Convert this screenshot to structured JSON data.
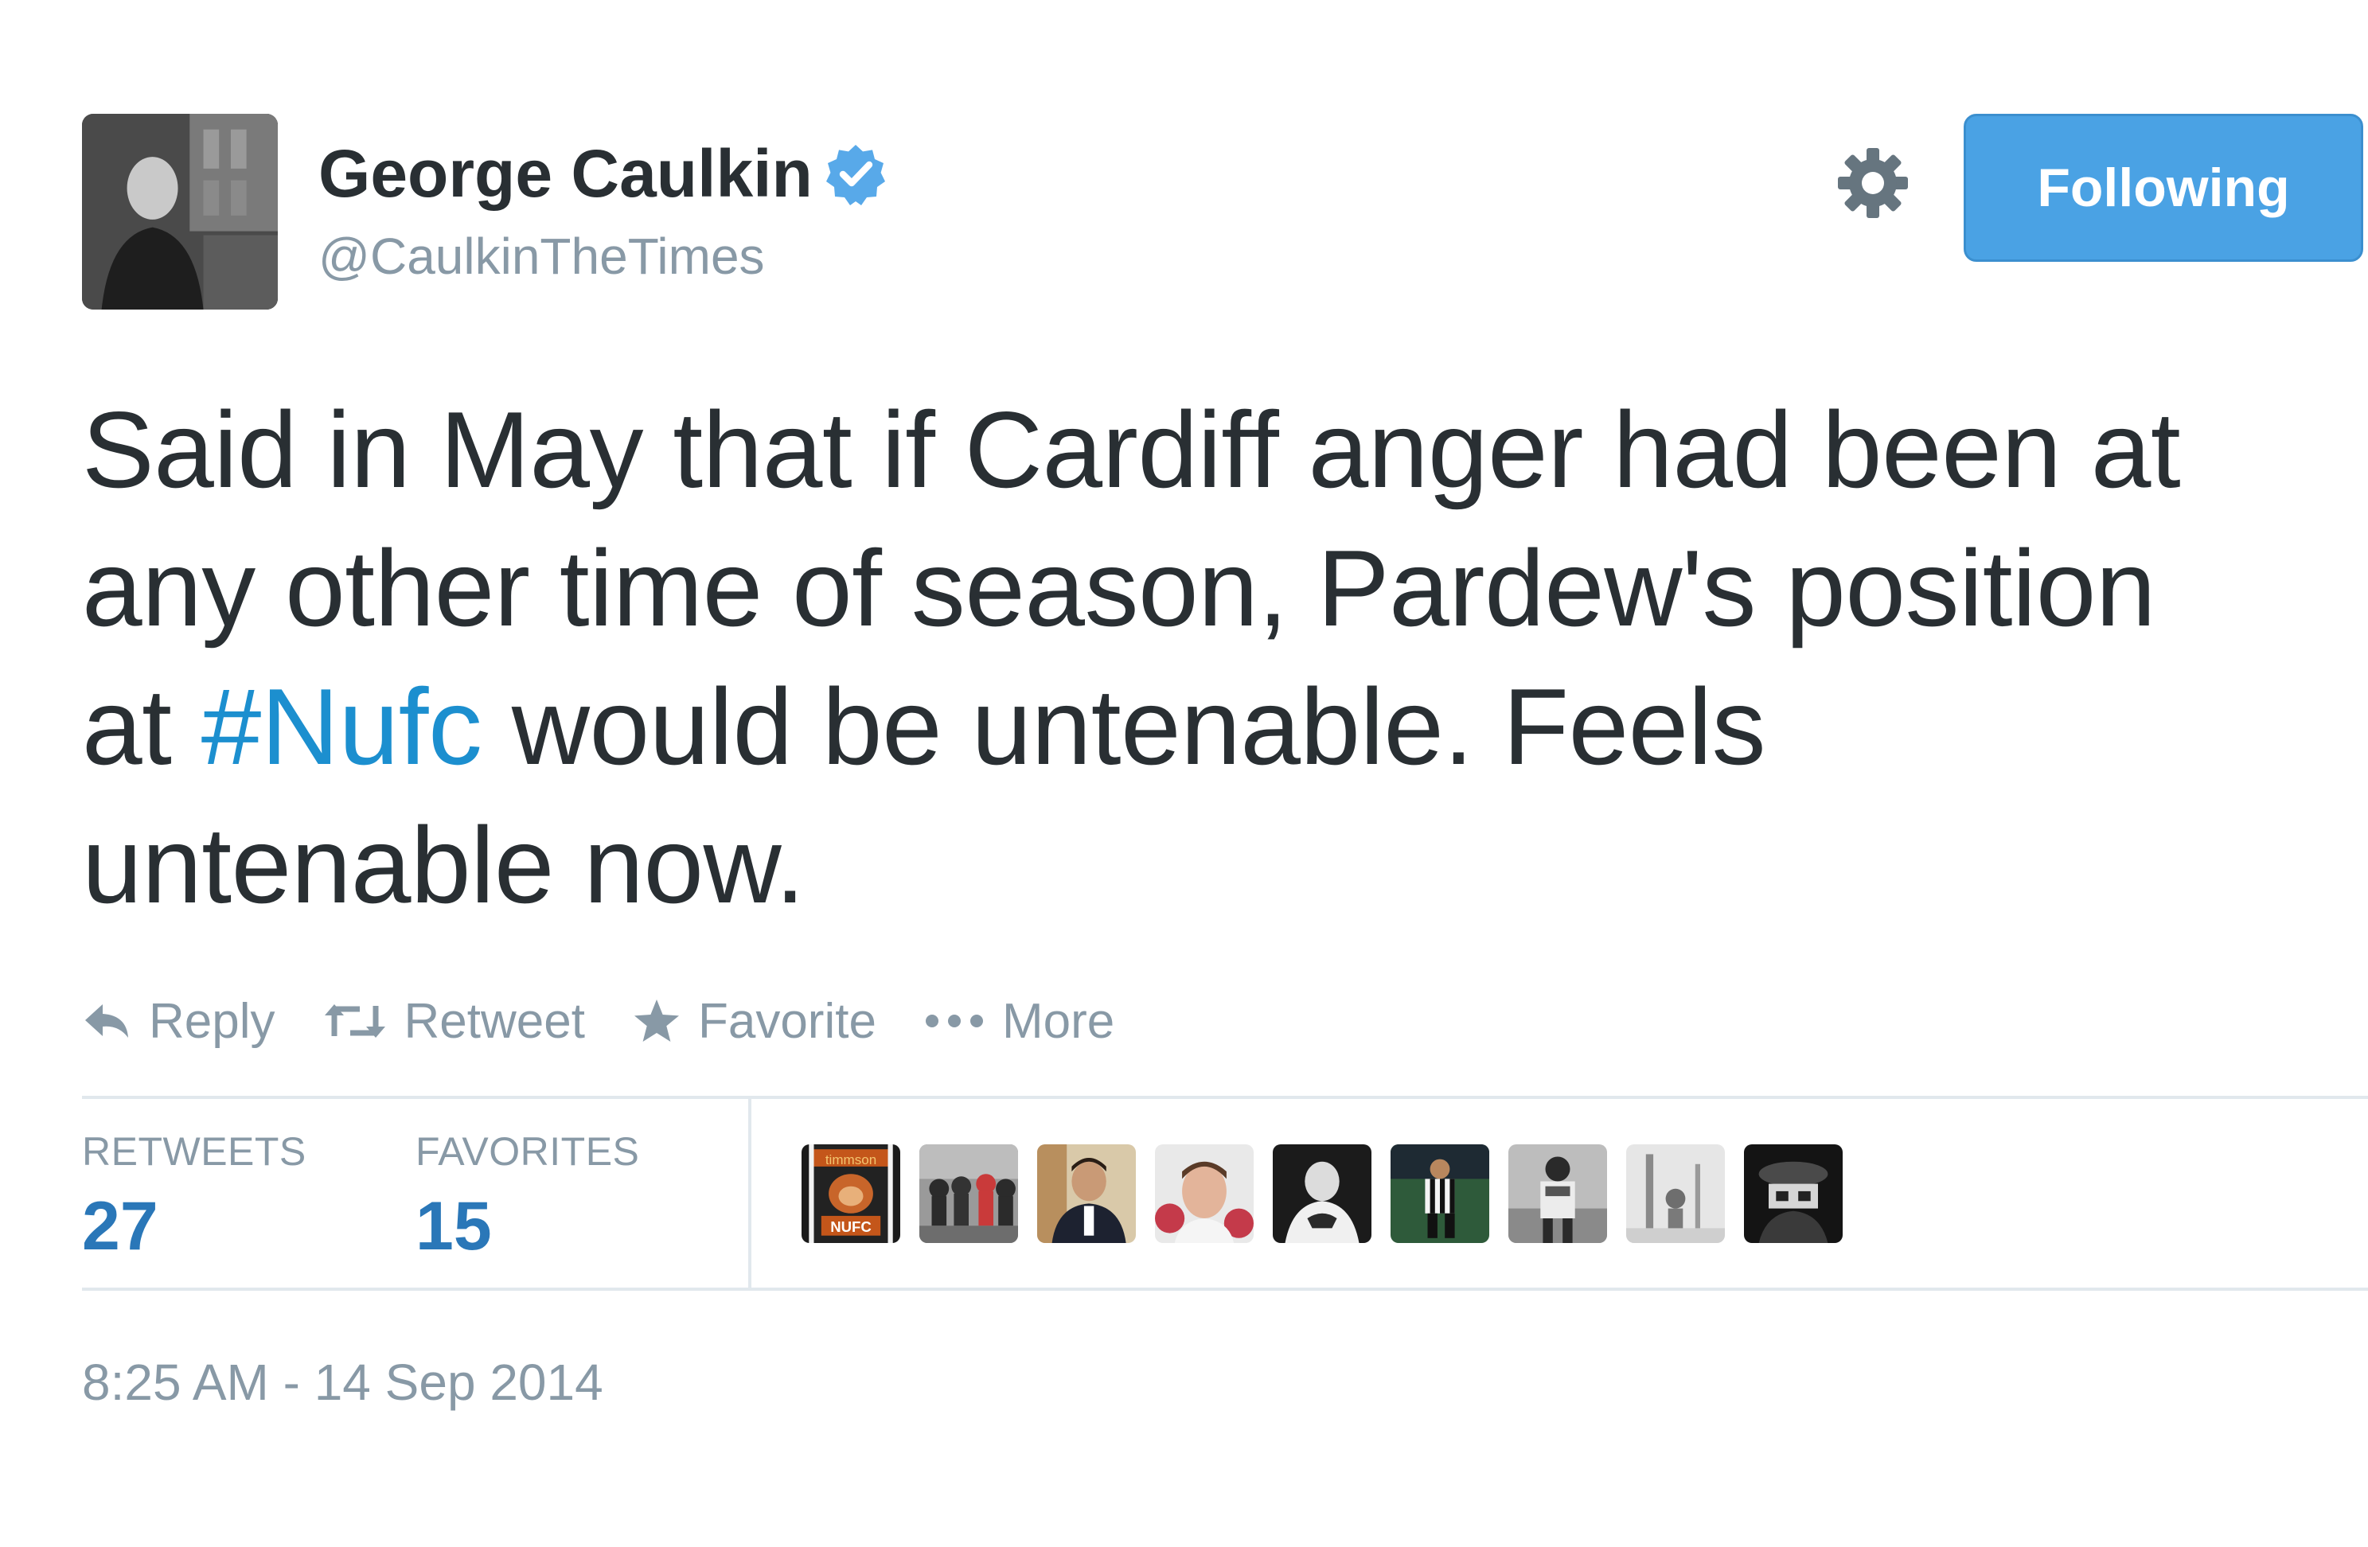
{
  "header": {
    "display_name": "George Caulkin",
    "handle": "@CaulkinTheTimes",
    "follow_label": "Following"
  },
  "tweet": {
    "line1": "Said in May that if Cardiff anger had been at",
    "line2": "any other time of season, Pardew's position",
    "line3_prefix": "at ",
    "hashtag": "#Nufc",
    "line3_suffix": " would be untenable. Feels",
    "line4": "untenable now."
  },
  "actions": {
    "reply": "Reply",
    "retweet": "Retweet",
    "favorite": "Favorite",
    "more": "More"
  },
  "stats": {
    "retweets_label": "RETWEETS",
    "retweets_value": "27",
    "favorites_label": "FAVORITES",
    "favorites_value": "15"
  },
  "favoriter_badge_text": {
    "top": "timmson",
    "bottom": "NUFC"
  },
  "timestamp": "8:25 AM - 14 Sep 2014",
  "icons": [
    "verified-icon",
    "gear-icon",
    "reply-icon",
    "retweet-icon",
    "star-icon",
    "ellipsis-icon"
  ],
  "colors": {
    "accent": "#4aa2e4",
    "hashtag": "#1c8fcf",
    "stat_value": "#2a77b8",
    "muted": "#8899a6",
    "text": "#292f33",
    "divider": "#e1e8ed"
  }
}
